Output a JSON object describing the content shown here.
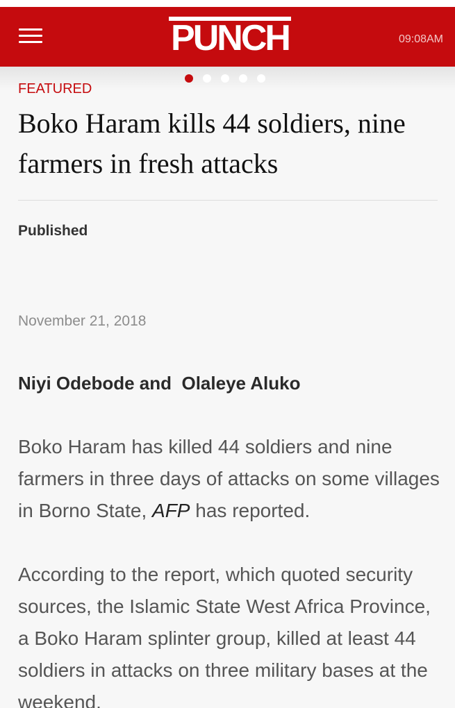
{
  "header": {
    "logo_text": "PUNCH",
    "time": "09:08AM",
    "brand_color": "#c50b0e"
  },
  "icons": {
    "menu": "hamburger-menu-icon"
  },
  "carousel": {
    "dot_count": 5,
    "active_index": 0
  },
  "article": {
    "category": "FEATURED",
    "headline": "Boko Haram kills 44 soldiers, nine farmers in fresh attacks",
    "published_label": "Published",
    "date": "November 21, 2018",
    "authors": "Niyi Odebode and  Olaleye Aluko",
    "para1": {
      "before": "Boko Haram has killed 44  soldiers and nine farmers in three days of attacks on some villages in  Borno State,  ",
      "source": "AFP",
      "after": " has reported."
    },
    "para2": "According to the report, which quoted security sources, the Islamic State West Africa Province, a Boko Haram splinter group, killed at least 44 soldiers in attacks on three military bases at the weekend."
  }
}
